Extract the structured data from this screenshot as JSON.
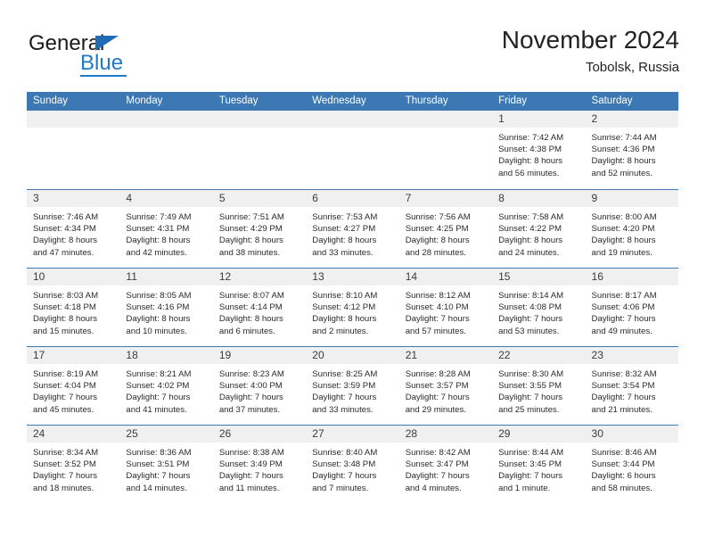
{
  "brand": {
    "word_one": "General",
    "word_two": "Blue",
    "accent_color": "#2079c6",
    "triangle_icon": "triangle-icon"
  },
  "header": {
    "title": "November 2024",
    "subtitle": "Tobolsk, Russia"
  },
  "theme": {
    "header_blue": "#3b78b4",
    "day_strip_gray": "#f0f0f0",
    "text": "#2b2b2b"
  },
  "calendar": {
    "weekday_headers": [
      "Sunday",
      "Monday",
      "Tuesday",
      "Wednesday",
      "Thursday",
      "Friday",
      "Saturday"
    ],
    "weeks": [
      [
        {
          "day": "",
          "empty": true
        },
        {
          "day": "",
          "empty": true
        },
        {
          "day": "",
          "empty": true
        },
        {
          "day": "",
          "empty": true
        },
        {
          "day": "",
          "empty": true
        },
        {
          "day": "1",
          "sunrise": "Sunrise: 7:42 AM",
          "sunset": "Sunset: 4:38 PM",
          "daylight1": "Daylight: 8 hours",
          "daylight2": "and 56 minutes."
        },
        {
          "day": "2",
          "sunrise": "Sunrise: 7:44 AM",
          "sunset": "Sunset: 4:36 PM",
          "daylight1": "Daylight: 8 hours",
          "daylight2": "and 52 minutes."
        }
      ],
      [
        {
          "day": "3",
          "sunrise": "Sunrise: 7:46 AM",
          "sunset": "Sunset: 4:34 PM",
          "daylight1": "Daylight: 8 hours",
          "daylight2": "and 47 minutes."
        },
        {
          "day": "4",
          "sunrise": "Sunrise: 7:49 AM",
          "sunset": "Sunset: 4:31 PM",
          "daylight1": "Daylight: 8 hours",
          "daylight2": "and 42 minutes."
        },
        {
          "day": "5",
          "sunrise": "Sunrise: 7:51 AM",
          "sunset": "Sunset: 4:29 PM",
          "daylight1": "Daylight: 8 hours",
          "daylight2": "and 38 minutes."
        },
        {
          "day": "6",
          "sunrise": "Sunrise: 7:53 AM",
          "sunset": "Sunset: 4:27 PM",
          "daylight1": "Daylight: 8 hours",
          "daylight2": "and 33 minutes."
        },
        {
          "day": "7",
          "sunrise": "Sunrise: 7:56 AM",
          "sunset": "Sunset: 4:25 PM",
          "daylight1": "Daylight: 8 hours",
          "daylight2": "and 28 minutes."
        },
        {
          "day": "8",
          "sunrise": "Sunrise: 7:58 AM",
          "sunset": "Sunset: 4:22 PM",
          "daylight1": "Daylight: 8 hours",
          "daylight2": "and 24 minutes."
        },
        {
          "day": "9",
          "sunrise": "Sunrise: 8:00 AM",
          "sunset": "Sunset: 4:20 PM",
          "daylight1": "Daylight: 8 hours",
          "daylight2": "and 19 minutes."
        }
      ],
      [
        {
          "day": "10",
          "sunrise": "Sunrise: 8:03 AM",
          "sunset": "Sunset: 4:18 PM",
          "daylight1": "Daylight: 8 hours",
          "daylight2": "and 15 minutes."
        },
        {
          "day": "11",
          "sunrise": "Sunrise: 8:05 AM",
          "sunset": "Sunset: 4:16 PM",
          "daylight1": "Daylight: 8 hours",
          "daylight2": "and 10 minutes."
        },
        {
          "day": "12",
          "sunrise": "Sunrise: 8:07 AM",
          "sunset": "Sunset: 4:14 PM",
          "daylight1": "Daylight: 8 hours",
          "daylight2": "and 6 minutes."
        },
        {
          "day": "13",
          "sunrise": "Sunrise: 8:10 AM",
          "sunset": "Sunset: 4:12 PM",
          "daylight1": "Daylight: 8 hours",
          "daylight2": "and 2 minutes."
        },
        {
          "day": "14",
          "sunrise": "Sunrise: 8:12 AM",
          "sunset": "Sunset: 4:10 PM",
          "daylight1": "Daylight: 7 hours",
          "daylight2": "and 57 minutes."
        },
        {
          "day": "15",
          "sunrise": "Sunrise: 8:14 AM",
          "sunset": "Sunset: 4:08 PM",
          "daylight1": "Daylight: 7 hours",
          "daylight2": "and 53 minutes."
        },
        {
          "day": "16",
          "sunrise": "Sunrise: 8:17 AM",
          "sunset": "Sunset: 4:06 PM",
          "daylight1": "Daylight: 7 hours",
          "daylight2": "and 49 minutes."
        }
      ],
      [
        {
          "day": "17",
          "sunrise": "Sunrise: 8:19 AM",
          "sunset": "Sunset: 4:04 PM",
          "daylight1": "Daylight: 7 hours",
          "daylight2": "and 45 minutes."
        },
        {
          "day": "18",
          "sunrise": "Sunrise: 8:21 AM",
          "sunset": "Sunset: 4:02 PM",
          "daylight1": "Daylight: 7 hours",
          "daylight2": "and 41 minutes."
        },
        {
          "day": "19",
          "sunrise": "Sunrise: 8:23 AM",
          "sunset": "Sunset: 4:00 PM",
          "daylight1": "Daylight: 7 hours",
          "daylight2": "and 37 minutes."
        },
        {
          "day": "20",
          "sunrise": "Sunrise: 8:25 AM",
          "sunset": "Sunset: 3:59 PM",
          "daylight1": "Daylight: 7 hours",
          "daylight2": "and 33 minutes."
        },
        {
          "day": "21",
          "sunrise": "Sunrise: 8:28 AM",
          "sunset": "Sunset: 3:57 PM",
          "daylight1": "Daylight: 7 hours",
          "daylight2": "and 29 minutes."
        },
        {
          "day": "22",
          "sunrise": "Sunrise: 8:30 AM",
          "sunset": "Sunset: 3:55 PM",
          "daylight1": "Daylight: 7 hours",
          "daylight2": "and 25 minutes."
        },
        {
          "day": "23",
          "sunrise": "Sunrise: 8:32 AM",
          "sunset": "Sunset: 3:54 PM",
          "daylight1": "Daylight: 7 hours",
          "daylight2": "and 21 minutes."
        }
      ],
      [
        {
          "day": "24",
          "sunrise": "Sunrise: 8:34 AM",
          "sunset": "Sunset: 3:52 PM",
          "daylight1": "Daylight: 7 hours",
          "daylight2": "and 18 minutes."
        },
        {
          "day": "25",
          "sunrise": "Sunrise: 8:36 AM",
          "sunset": "Sunset: 3:51 PM",
          "daylight1": "Daylight: 7 hours",
          "daylight2": "and 14 minutes."
        },
        {
          "day": "26",
          "sunrise": "Sunrise: 8:38 AM",
          "sunset": "Sunset: 3:49 PM",
          "daylight1": "Daylight: 7 hours",
          "daylight2": "and 11 minutes."
        },
        {
          "day": "27",
          "sunrise": "Sunrise: 8:40 AM",
          "sunset": "Sunset: 3:48 PM",
          "daylight1": "Daylight: 7 hours",
          "daylight2": "and 7 minutes."
        },
        {
          "day": "28",
          "sunrise": "Sunrise: 8:42 AM",
          "sunset": "Sunset: 3:47 PM",
          "daylight1": "Daylight: 7 hours",
          "daylight2": "and 4 minutes."
        },
        {
          "day": "29",
          "sunrise": "Sunrise: 8:44 AM",
          "sunset": "Sunset: 3:45 PM",
          "daylight1": "Daylight: 7 hours",
          "daylight2": "and 1 minute."
        },
        {
          "day": "30",
          "sunrise": "Sunrise: 8:46 AM",
          "sunset": "Sunset: 3:44 PM",
          "daylight1": "Daylight: 6 hours",
          "daylight2": "and 58 minutes."
        }
      ]
    ]
  }
}
